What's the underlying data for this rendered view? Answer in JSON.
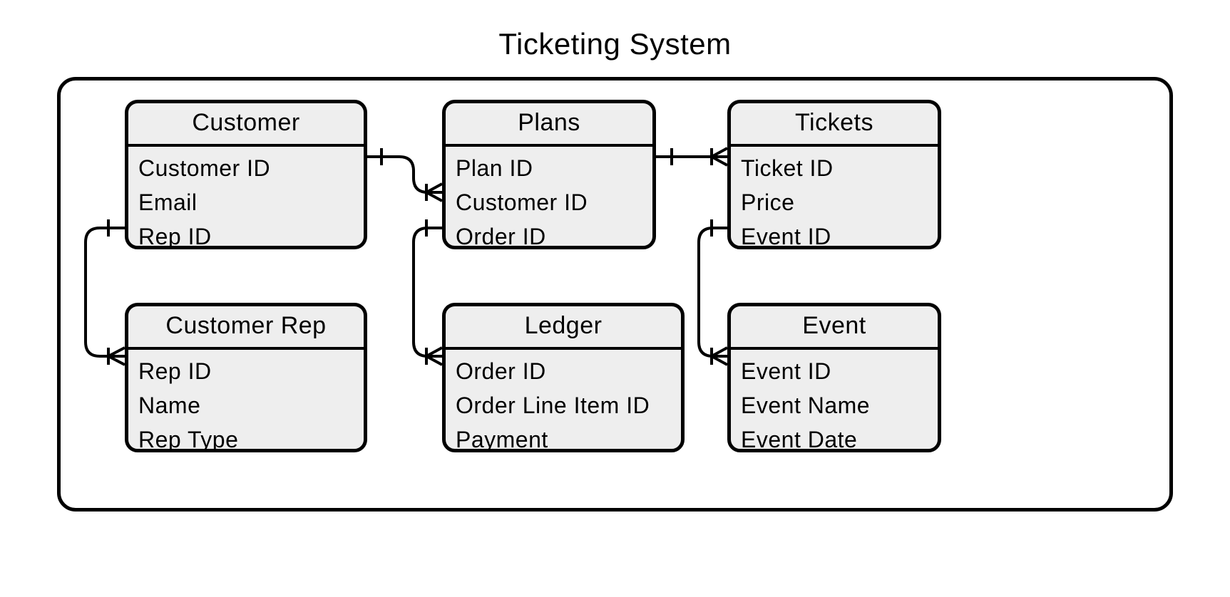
{
  "title": "Ticketing System",
  "entities": {
    "customer": {
      "name": "Customer",
      "attrs": [
        "Customer ID",
        "Email",
        "Rep ID"
      ]
    },
    "customer_rep": {
      "name": "Customer Rep",
      "attrs": [
        "Rep ID",
        "Name",
        "Rep Type"
      ]
    },
    "plans": {
      "name": "Plans",
      "attrs": [
        "Plan ID",
        "Customer ID",
        "Order ID"
      ]
    },
    "ledger": {
      "name": "Ledger",
      "attrs": [
        "Order ID",
        "Order Line Item ID",
        "Payment"
      ]
    },
    "tickets": {
      "name": "Tickets",
      "attrs": [
        "Ticket ID",
        "Price",
        "Event ID"
      ]
    },
    "event": {
      "name": "Event",
      "attrs": [
        "Event ID",
        "Event Name",
        "Event Date"
      ]
    }
  },
  "relationships": [
    {
      "from": "Customer",
      "to": "Customer Rep",
      "type": "one-to-many"
    },
    {
      "from": "Customer",
      "to": "Plans",
      "type": "one-to-many"
    },
    {
      "from": "Plans",
      "to": "Ledger",
      "type": "one-to-many"
    },
    {
      "from": "Plans",
      "to": "Tickets",
      "type": "one-to-many"
    },
    {
      "from": "Tickets",
      "to": "Event",
      "type": "one-to-many"
    }
  ]
}
